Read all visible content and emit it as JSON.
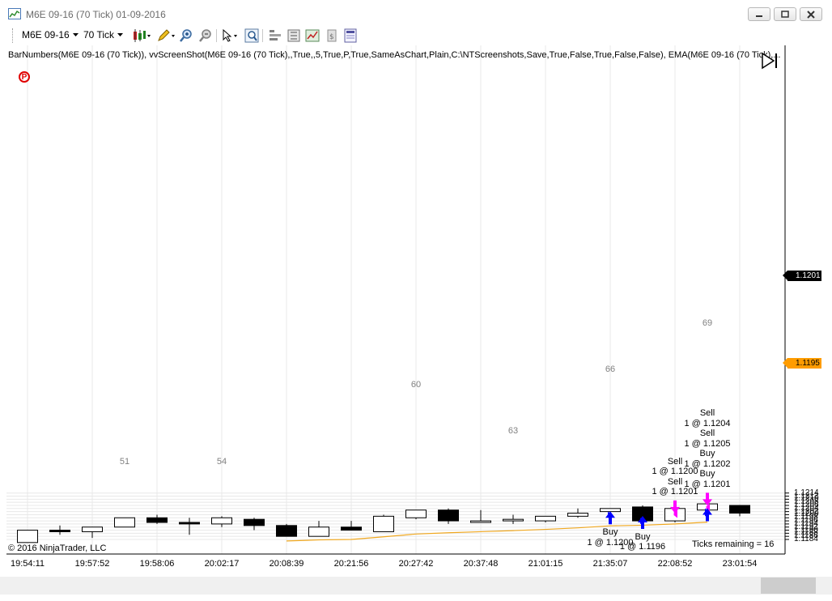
{
  "window": {
    "title": "M6E 09-16 (70 Tick)  01-09-2016"
  },
  "toolbar": {
    "instrument": "M6E 09-16",
    "interval": "70 Tick",
    "icons": [
      "candlestick-style-icon",
      "drawing-pencil-icon",
      "zoom-in-icon",
      "zoom-out-icon",
      "pointer-cursor-icon",
      "magnifier-icon",
      "data-box-icon",
      "chart-properties-icon",
      "strategies-icon",
      "templates-icon"
    ]
  },
  "chart": {
    "indicator_line": "BarNumbers(M6E 09-16 (70 Tick)), vvScreenShot(M6E 09-16 (70 Tick),,True,,5,True,P,True,SameAsChart,Plain,C:\\NTScreenshots,Save,True,False,True,False,False), EMA(M6E 09-16 (70 Tick),...",
    "p_marker": "P",
    "copyright": "© 2016 NinjaTrader, LLC",
    "ticks_remaining": "Ticks remaining = 16",
    "last_price": "1.1201",
    "ask_price": "1.1195",
    "colors": {
      "up_bar": "#ffffff",
      "down_bar": "#000000",
      "ema": "#f0a820",
      "buy": "#0000ff",
      "sell": "#ff00ff",
      "grid": "#e8e8e8"
    }
  },
  "chart_data": {
    "type": "candlestick",
    "title": "",
    "ylim": [
      1.1183,
      1.1217
    ],
    "y_ticks": [
      "1.1184",
      "1.1186",
      "1.1188",
      "1.1190",
      "1.1192",
      "1.1194",
      "1.1196",
      "1.1198",
      "1.1200",
      "1.1202",
      "1.1204",
      "1.1206",
      "1.1208",
      "1.1210",
      "1.1212",
      "1.1214"
    ],
    "x_ticks": [
      "19:54:11",
      "19:57:52",
      "19:58:06",
      "20:02:17",
      "20:08:39",
      "20:21:56",
      "20:27:42",
      "20:37:48",
      "21:01:15",
      "21:35:07",
      "22:08:52",
      "23:01:54"
    ],
    "bar_numbers": [
      {
        "bar": 51,
        "label": "51"
      },
      {
        "bar": 54,
        "label": "54"
      },
      {
        "bar": 60,
        "label": "60"
      },
      {
        "bar": 63,
        "label": "63"
      },
      {
        "bar": 66,
        "label": "66"
      },
      {
        "bar": 69,
        "label": "69"
      }
    ],
    "bars": [
      {
        "n": 48,
        "o": 1.1182,
        "h": 1.119,
        "l": 1.1182,
        "c": 1.119
      },
      {
        "n": 49,
        "o": 1.119,
        "h": 1.1193,
        "l": 1.1187,
        "c": 1.1189
      },
      {
        "n": 50,
        "o": 1.1189,
        "h": 1.1192,
        "l": 1.1185,
        "c": 1.1192
      },
      {
        "n": 51,
        "o": 1.1192,
        "h": 1.1198,
        "l": 1.1192,
        "c": 1.1198
      },
      {
        "n": 52,
        "o": 1.1198,
        "h": 1.12,
        "l": 1.1194,
        "c": 1.1195
      },
      {
        "n": 53,
        "o": 1.1195,
        "h": 1.1198,
        "l": 1.1187,
        "c": 1.1194
      },
      {
        "n": 54,
        "o": 1.1194,
        "h": 1.1199,
        "l": 1.1192,
        "c": 1.1198
      },
      {
        "n": 55,
        "o": 1.1197,
        "h": 1.1198,
        "l": 1.119,
        "c": 1.1193
      },
      {
        "n": 56,
        "o": 1.1193,
        "h": 1.1194,
        "l": 1.1186,
        "c": 1.1186
      },
      {
        "n": 57,
        "o": 1.1186,
        "h": 1.1196,
        "l": 1.1186,
        "c": 1.1192
      },
      {
        "n": 58,
        "o": 1.1192,
        "h": 1.1196,
        "l": 1.119,
        "c": 1.119
      },
      {
        "n": 59,
        "o": 1.1189,
        "h": 1.12,
        "l": 1.1189,
        "c": 1.1199
      },
      {
        "n": 60,
        "o": 1.1198,
        "h": 1.1203,
        "l": 1.1197,
        "c": 1.1203
      },
      {
        "n": 61,
        "o": 1.1203,
        "h": 1.1204,
        "l": 1.1194,
        "c": 1.1196
      },
      {
        "n": 62,
        "o": 1.1195,
        "h": 1.1203,
        "l": 1.1195,
        "c": 1.1196
      },
      {
        "n": 63,
        "o": 1.1196,
        "h": 1.12,
        "l": 1.1194,
        "c": 1.1197
      },
      {
        "n": 64,
        "o": 1.1196,
        "h": 1.1199,
        "l": 1.1195,
        "c": 1.1199
      },
      {
        "n": 65,
        "o": 1.1199,
        "h": 1.1204,
        "l": 1.1198,
        "c": 1.1201
      },
      {
        "n": 66,
        "o": 1.1202,
        "h": 1.1204,
        "l": 1.1198,
        "c": 1.1204
      },
      {
        "n": 67,
        "o": 1.1205,
        "h": 1.1206,
        "l": 1.1195,
        "c": 1.1196
      },
      {
        "n": 68,
        "o": 1.1196,
        "h": 1.1204,
        "l": 1.1195,
        "c": 1.1204
      },
      {
        "n": 69,
        "o": 1.1203,
        "h": 1.1209,
        "l": 1.1203,
        "c": 1.1207
      },
      {
        "n": 70,
        "o": 1.1206,
        "h": 1.1206,
        "l": 1.1199,
        "c": 1.1201
      }
    ],
    "ema": [
      {
        "n": 56,
        "v": 1.1183
      },
      {
        "n": 57,
        "v": 1.11837
      },
      {
        "n": 58,
        "v": 1.1184
      },
      {
        "n": 59,
        "v": 1.11857
      },
      {
        "n": 60,
        "v": 1.11875
      },
      {
        "n": 61,
        "v": 1.11883
      },
      {
        "n": 62,
        "v": 1.1189
      },
      {
        "n": 63,
        "v": 1.11897
      },
      {
        "n": 64,
        "v": 1.11905
      },
      {
        "n": 65,
        "v": 1.11915
      },
      {
        "n": 66,
        "v": 1.11928
      },
      {
        "n": 67,
        "v": 1.11932
      },
      {
        "n": 68,
        "v": 1.1194
      },
      {
        "n": 69,
        "v": 1.11952
      }
    ],
    "executions": [
      {
        "n": 66,
        "side": "buy",
        "lines": [
          "Buy",
          "1 @ 1.1200"
        ],
        "price": 1.1198,
        "label_pos": "below"
      },
      {
        "n": 67,
        "side": "buy",
        "lines": [
          "Buy",
          "1 @ 1.1196"
        ],
        "price": 1.1195,
        "label_pos": "below"
      },
      {
        "n": 68,
        "side": "sell",
        "lines": [
          "Sell",
          "1 @ 1.1200",
          "Sell",
          "1 @ 1.1201"
        ],
        "price": 1.1205,
        "label_pos": "above"
      },
      {
        "n": 69,
        "side": "sell",
        "lines": [
          "Sell",
          "1 @ 1.1204",
          "Sell",
          "1 @ 1.1205",
          "Buy",
          "1 @ 1.1202",
          "Buy",
          "1 @ 1.1201"
        ],
        "price": 1.121,
        "label_pos": "above"
      },
      {
        "n": 69,
        "side": "buy",
        "lines": [],
        "price": 1.12,
        "label_pos": "none"
      }
    ],
    "fill_markers": [
      {
        "n": 66,
        "side": "buy",
        "price": 1.12
      },
      {
        "n": 67,
        "side": "buy",
        "price": 1.1196
      },
      {
        "n": 68,
        "side": "sell",
        "price": 1.12
      },
      {
        "n": 68,
        "side": "sell",
        "price": 1.1201
      },
      {
        "n": 69,
        "side": "sell",
        "price": 1.1204
      },
      {
        "n": 69,
        "side": "sell",
        "price": 1.1205
      },
      {
        "n": 69,
        "side": "buy",
        "price": 1.1202
      },
      {
        "n": 69,
        "side": "buy",
        "price": 1.1201
      }
    ]
  }
}
